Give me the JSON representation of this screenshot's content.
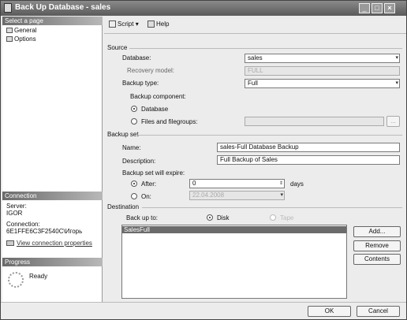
{
  "window": {
    "title": "Back Up Database - sales",
    "minimize": "_",
    "maximize": "□",
    "close": "×"
  },
  "left": {
    "select_page": "Select a page",
    "pages": [
      "General",
      "Options"
    ],
    "connection_header": "Connection",
    "server_label": "Server:",
    "server_value": "IGOR",
    "connection_label": "Connection:",
    "connection_value": "6E1FFE6C3F2540C\\Игорь",
    "view_link": "View connection properties",
    "progress_header": "Progress",
    "progress_status": "Ready"
  },
  "toolbar": {
    "script": "Script",
    "help": "Help"
  },
  "source": {
    "header": "Source",
    "database_label": "Database:",
    "database_value": "sales",
    "recovery_label": "Recovery model:",
    "recovery_value": "FULL",
    "backup_type_label": "Backup type:",
    "backup_type_value": "Full",
    "component_label": "Backup component:",
    "database_radio": "Database",
    "files_radio": "Files and filegroups:",
    "files_button": "..."
  },
  "backup_set": {
    "header": "Backup set",
    "name_label": "Name:",
    "name_value": "sales-Full Database Backup",
    "description_label": "Description:",
    "description_value": "Full Backup of Sales",
    "expire_label": "Backup set will expire:",
    "after_label": "After:",
    "after_value": "0",
    "days_label": "days",
    "on_label": "On:",
    "on_value": "22.04.2008"
  },
  "destination": {
    "header": "Destination",
    "back_up_to_label": "Back up to:",
    "disk_label": "Disk",
    "tape_label": "Tape",
    "items": [
      "SalesFull"
    ],
    "add_button": "Add...",
    "remove_button": "Remove",
    "contents_button": "Contents"
  },
  "footer": {
    "ok": "OK",
    "cancel": "Cancel"
  }
}
